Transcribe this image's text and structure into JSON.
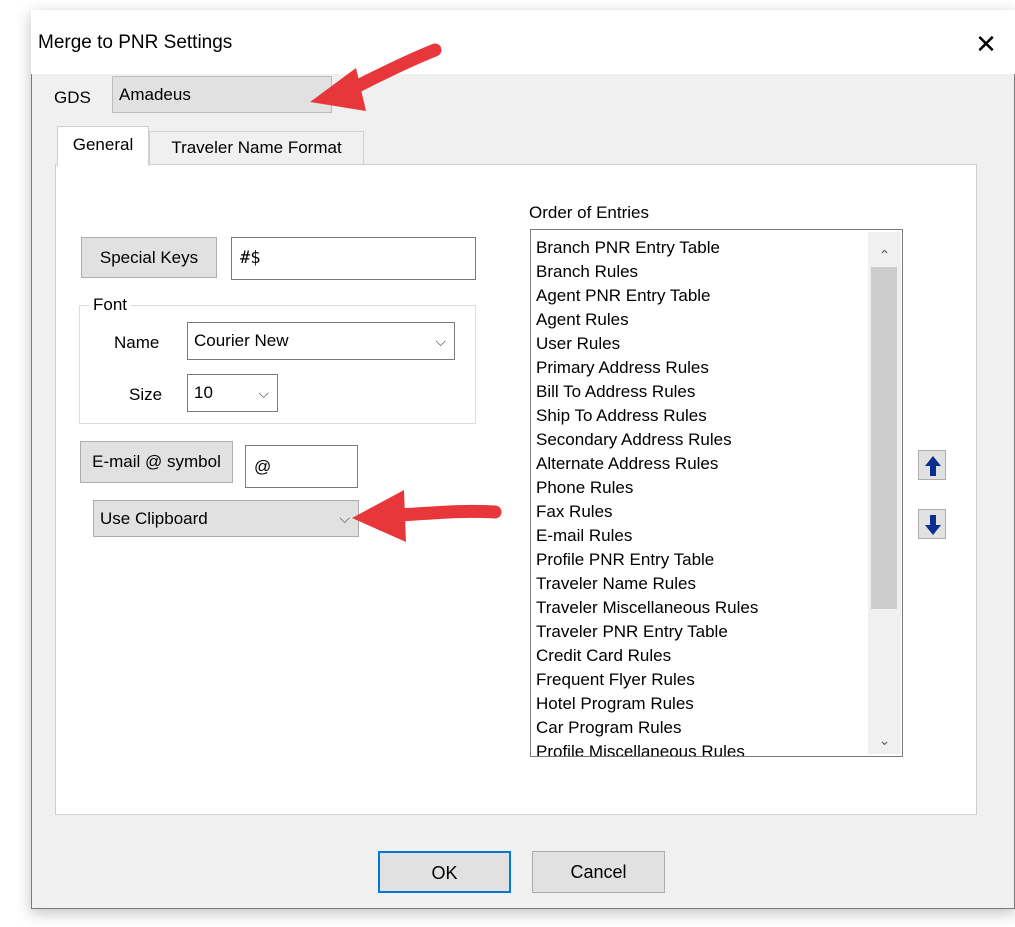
{
  "window": {
    "title": "Merge to PNR Settings",
    "close_glyph": "✕"
  },
  "gds": {
    "label": "GDS",
    "value": "Amadeus"
  },
  "tabs": [
    {
      "label": "General",
      "active": true
    },
    {
      "label": "Traveler Name Format",
      "active": false
    }
  ],
  "general": {
    "special_keys": {
      "button_label": "Special Keys",
      "value": "#$"
    },
    "font": {
      "group_label": "Font",
      "name_label": "Name",
      "name_value": "Courier New",
      "size_label": "Size",
      "size_value": "10"
    },
    "email": {
      "button_label": "E-mail @ symbol",
      "value": "@"
    },
    "clipboard_select": {
      "value": "Use Clipboard"
    }
  },
  "order": {
    "label": "Order of Entries",
    "items": [
      "Branch PNR Entry Table",
      "Branch Rules",
      "Agent PNR Entry Table",
      "Agent Rules",
      "User Rules",
      "Primary Address Rules",
      "Bill To Address Rules",
      "Ship To Address Rules",
      "Secondary Address Rules",
      "Alternate Address Rules",
      "Phone Rules",
      "Fax Rules",
      "E-mail Rules",
      "Profile PNR Entry Table",
      "Traveler Name Rules",
      "Traveler Miscellaneous Rules",
      "Traveler PNR Entry Table",
      "Credit Card Rules",
      "Frequent Flyer Rules",
      "Hotel Program Rules",
      "Car Program Rules",
      "Profile Miscellaneous Rules"
    ],
    "scroll_thumb_fraction": 0.7
  },
  "footer": {
    "ok_label": "OK",
    "cancel_label": "Cancel"
  },
  "icons": {
    "close": "close-icon",
    "chevron": "chevron-down-icon",
    "move_up": "arrow-up-icon",
    "move_down": "arrow-down-icon",
    "annotation": "red-annotation-arrow-icon"
  },
  "colors": {
    "annotation_red": "#e8373b",
    "move_arrow_blue": "#0b2f8f",
    "default_button_border": "#0078d7"
  }
}
